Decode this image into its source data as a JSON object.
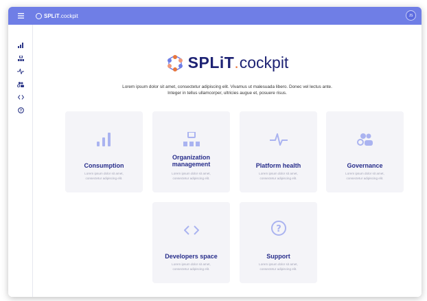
{
  "header": {
    "brand_split": "SPLiT",
    "brand_cockpit": ".cockpit",
    "avatar_initials": "JS",
    "accent": "#6f7ee6"
  },
  "sidebar": {
    "items": [
      {
        "name": "sidebar-item-consumption",
        "icon": "bar-chart-icon",
        "glyph": "▖▌"
      },
      {
        "name": "sidebar-item-organization",
        "icon": "org-chart-icon",
        "glyph": "⊟"
      },
      {
        "name": "sidebar-item-platform-health",
        "icon": "pulse-icon",
        "glyph": "∿"
      },
      {
        "name": "sidebar-item-governance",
        "icon": "people-icon",
        "glyph": "⚇"
      },
      {
        "name": "sidebar-item-developers",
        "icon": "code-icon",
        "glyph": "<>"
      },
      {
        "name": "sidebar-item-support",
        "icon": "help-icon",
        "glyph": "?"
      }
    ]
  },
  "logo": {
    "split": "SPLiT",
    "dot": ".",
    "cockpit": "cockpit"
  },
  "intro": {
    "line1": "Lorem ipsum dolor sit amet, consectetur adipiscing elit. Vivamus ut malesuada libero. Donec vel lectus ante.",
    "line2": "Integer in tellus ullamcorper, ultricies augue et, posuere risus."
  },
  "cards": [
    {
      "title": "Consumption",
      "desc1": "Lorem ipsum dolor sit amet,",
      "desc2": "consectetur adipiscing elit.",
      "icon": "bar-chart-icon"
    },
    {
      "title1": "Organization",
      "title2": "management",
      "desc1": "Lorem ipsum dolor sit amet,",
      "desc2": "consectetur adipiscing elit.",
      "icon": "org-chart-icon"
    },
    {
      "title": "Platform health",
      "desc1": "Lorem ipsum dolor sit amet,",
      "desc2": "consectetur adipiscing elit.",
      "icon": "pulse-icon"
    },
    {
      "title": "Governance",
      "desc1": "Lorem ipsum dolor sit amet,",
      "desc2": "consectetur adipiscing elit.",
      "icon": "people-icon"
    },
    {
      "title": "Developers space",
      "desc1": "Lorem ipsum dolor sit amet,",
      "desc2": "consectetur adipiscing elit.",
      "icon": "code-icon"
    },
    {
      "title": "Support",
      "desc1": "Lorem ipsum dolor sit amet,",
      "desc2": "consectetur adipiscing elit.",
      "icon": "help-icon"
    }
  ],
  "colors": {
    "title": "#262c8a",
    "icon": "#aab3f0",
    "card_bg": "#f4f4f8"
  }
}
